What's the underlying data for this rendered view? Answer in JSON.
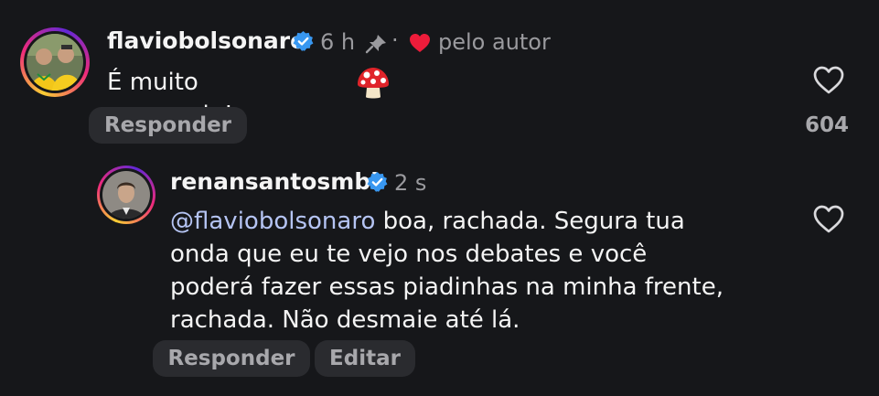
{
  "comment": {
    "username": "flaviobolsonaro",
    "time": "6 h",
    "liked_by": "pelo autor",
    "text": "É muito cogumelo!",
    "reply_label": "Responder",
    "like_count": "604"
  },
  "reply": {
    "username": "renansantosmbl",
    "time": "2 s",
    "mention": "@flaviobolsonaro",
    "line1": " boa, rachada. Segura tua",
    "line2": "onda que eu te vejo nos debates e você",
    "line3": "poderá fazer essas piadinhas na minha frente,",
    "line4": "rachada. Não desmaie até lá.",
    "reply_label": "Responder",
    "edit_label": "Editar"
  },
  "icons": {
    "verified": "verified-badge-icon",
    "pin": "pin-icon",
    "creator_heart": "heart-filled-icon",
    "like": "heart-outline-icon",
    "mushroom": "mushroom-emoji"
  },
  "colors": {
    "background": "#16171a",
    "verified": "#3897f0",
    "creator_heart": "#ed1c3a",
    "mention": "#b5c4f3",
    "pill": "#2a2b2f"
  }
}
